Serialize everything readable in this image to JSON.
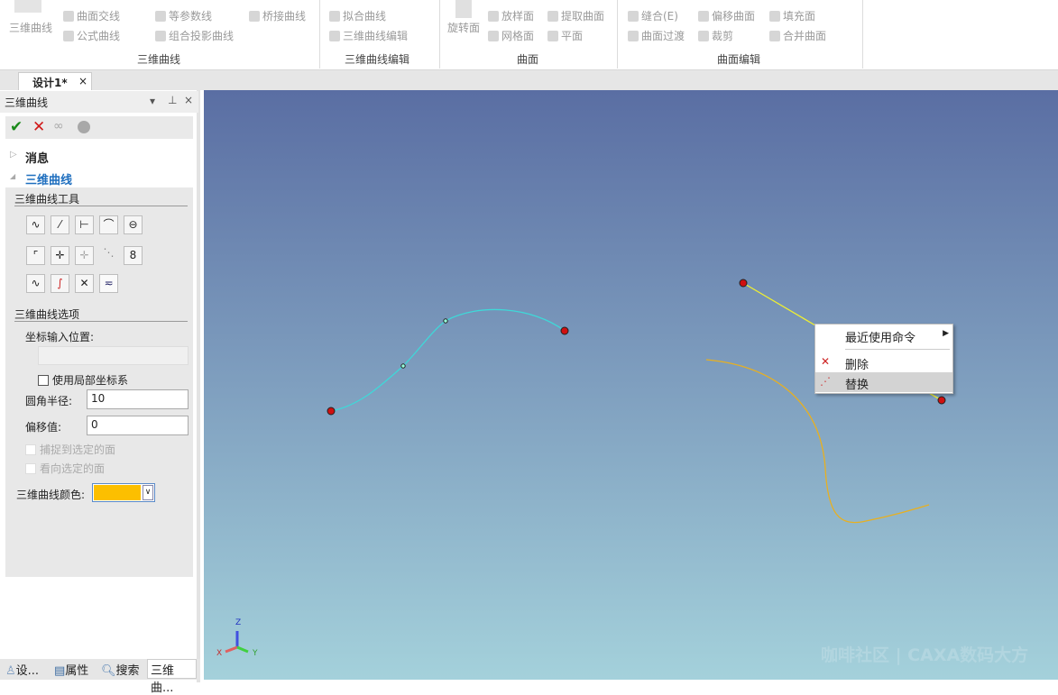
{
  "ribbon": {
    "big": {
      "sanwei": "三维曲线",
      "xuanzhuan": "旋转面"
    },
    "items": {
      "qmjx": "曲面交线",
      "gsqx": "公式曲线",
      "dcsx": "等参数线",
      "zhtyqx": "组合投影曲线",
      "qjqx": "桥接曲线",
      "nhqx": "拟合曲线",
      "swqxbj": "三维曲线编辑",
      "fym": "放样面",
      "wgm": "网格面",
      "tqqm": "提取曲面",
      "pm": "平面",
      "fh": "缝合(E)",
      "qmgd": "曲面过渡",
      "pyqm": "偏移曲面",
      "cj": "裁剪",
      "tcm": "填充面",
      "hbqm": "合并曲面"
    },
    "groups": {
      "g1": "三维曲线",
      "g2": "三维曲线编辑",
      "g3": "曲面",
      "g4": "曲面编辑"
    }
  },
  "doc_tab": {
    "label": "设计1*",
    "close": "×"
  },
  "panel": {
    "title": "三维曲线",
    "dropdown": "▾",
    "pin": "ᵖ",
    "close": "×",
    "tree": {
      "messages": "消息",
      "curve": "三维曲线"
    },
    "tools_title": "三维曲线工具",
    "options_title": "三维曲线选项",
    "coord_label": "坐标输入位置:",
    "coord_value": "",
    "local_cs": "使用局部坐标系",
    "fillet_label": "圆角半径:",
    "fillet_value": "10",
    "offset_label": "偏移值:",
    "offset_value": "0",
    "snap_face": "捕捉到选定的面",
    "look_face": "看向选定的面",
    "color_label": "三维曲线颜色:",
    "color_value": "#fcbf00"
  },
  "bottom_tabs": [
    "设...",
    "属性",
    "搜索",
    "三维曲..."
  ],
  "context_menu": {
    "recent": "最近使用命令",
    "delete": "删除",
    "replace": "替换"
  },
  "triad": {
    "z": "Z",
    "x": "X",
    "y": "Y"
  },
  "watermark": "咖啡社区 | CAXA数码大方"
}
